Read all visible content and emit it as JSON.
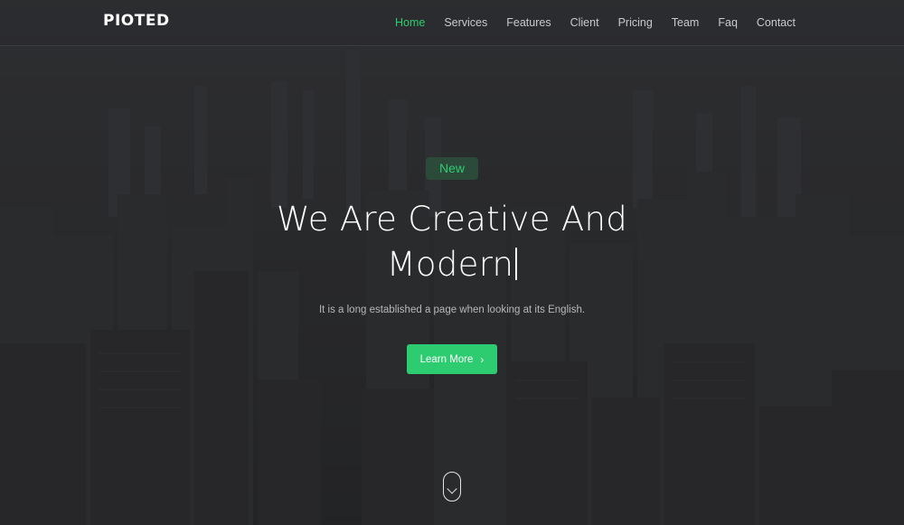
{
  "brand": {
    "logo_text": "PIOTED"
  },
  "nav": {
    "items": [
      {
        "label": "Home",
        "active": true
      },
      {
        "label": "Services",
        "active": false
      },
      {
        "label": "Features",
        "active": false
      },
      {
        "label": "Client",
        "active": false
      },
      {
        "label": "Pricing",
        "active": false
      },
      {
        "label": "Team",
        "active": false
      },
      {
        "label": "Faq",
        "active": false
      },
      {
        "label": "Contact",
        "active": false
      }
    ]
  },
  "hero": {
    "badge": "New",
    "headline_line1": "We Are Creative And",
    "headline_line2": "Modern",
    "subtitle": "It is a long established a page when looking at its English.",
    "cta_label": "Learn More",
    "cta_icon": "chevron-right-icon",
    "scroll_icon": "mouse-scroll-down-icon"
  },
  "colors": {
    "accent": "#2ecc71",
    "badge_bg": "#2c4a3a",
    "overlay": "#2b2c2e",
    "nav_text": "#c9cacc"
  }
}
